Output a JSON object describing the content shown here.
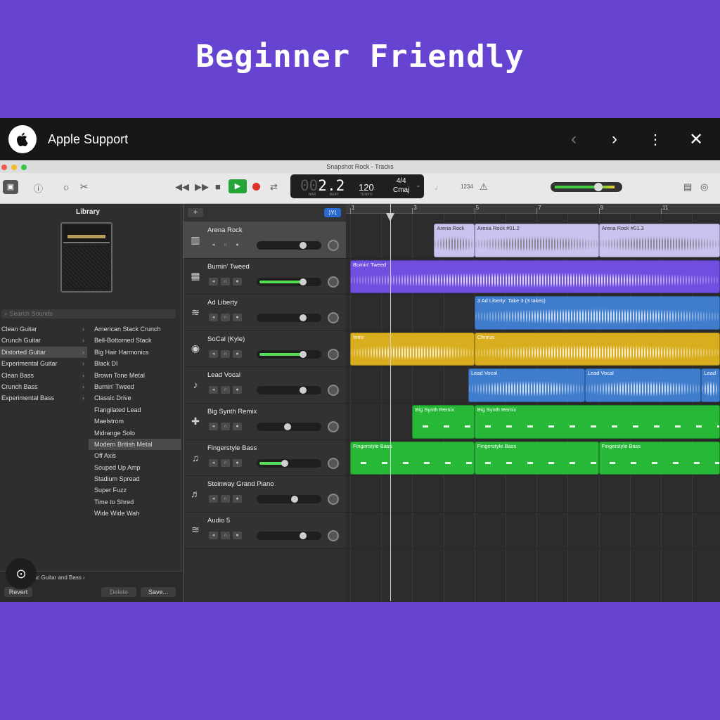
{
  "banner": {
    "title": "Beginner Friendly"
  },
  "video_bar": {
    "channel": "Apple Support",
    "icons": [
      "apple-logo-icon",
      "chevron-left-icon",
      "chevron-right-icon",
      "more-vertical-icon",
      "close-icon"
    ]
  },
  "window": {
    "title": "Snapshot Rock - Tracks"
  },
  "lcd": {
    "position_dim": "00",
    "position": "2.2",
    "tempo": "120",
    "time_signature": "4/4",
    "key": "Cmaj",
    "labels": {
      "bar": "BAR",
      "beat": "BEAT",
      "tempo": "TEMPO"
    }
  },
  "toolbar": {
    "count_in": "1234"
  },
  "library": {
    "title": "Library",
    "search_placeholder": "Search Sounds",
    "categories": [
      "Clean Guitar",
      "Crunch Guitar",
      "Distorted Guitar",
      "Experimental Guitar",
      "Clean Bass",
      "Crunch Bass",
      "Experimental Bass"
    ],
    "selected_category": "Distorted Guitar",
    "patches": [
      "American Stack Crunch",
      "Bell-Bottomed Stack",
      "Big Hair Harmonics",
      "Black DI",
      "Brown Tone Metal",
      "Burnin' Tweed",
      "Classic Drive",
      "Flangilated Lead",
      "Maelstrom",
      "Midrange Solo",
      "Modern British Metal",
      "Off Axis",
      "Souped Up Amp",
      "Stadium Spread",
      "Super Fuzz",
      "Time to Shred",
      "Wide Wide Wah"
    ],
    "selected_patch": "Modern British Metal",
    "breadcrumb": "Electric Guitar and Bass",
    "buttons": {
      "revert": "Revert",
      "delete": "Delete",
      "save": "Save..."
    }
  },
  "tracks": [
    {
      "name": "Arena Rock",
      "icon": "amp-stack-icon",
      "volume": 0.72,
      "selected": true
    },
    {
      "name": "Burnin' Tweed",
      "icon": "tweed-amp-icon",
      "volume": 0.72,
      "active_meter": true
    },
    {
      "name": "Ad Liberty",
      "icon": "waveform-icon",
      "volume": 0.72
    },
    {
      "name": "SoCal (Kyle)",
      "icon": "drum-kit-icon",
      "volume": 0.72,
      "active_meter": true
    },
    {
      "name": "Lead Vocal",
      "icon": "microphone-icon",
      "volume": 0.72
    },
    {
      "name": "Big Synth Remix",
      "icon": "synth-icon",
      "volume": 0.42
    },
    {
      "name": "Fingerstyle Bass",
      "icon": "bass-guitar-icon",
      "volume": 0.36,
      "active_meter": true
    },
    {
      "name": "Steinway Grand Piano",
      "icon": "piano-icon",
      "volume": 0.56
    },
    {
      "name": "Audio 5",
      "icon": "waveform-icon",
      "volume": 0.72
    }
  ],
  "ruler": [
    "1",
    "3",
    "5",
    "7",
    "9",
    "11"
  ],
  "regions": [
    {
      "lane": 0,
      "label": "Arena Rock",
      "color": "#c9c3ef",
      "start": 2.7,
      "end": 4.0,
      "kind": "audio"
    },
    {
      "lane": 0,
      "label": "Arena Rock #01.2",
      "color": "#c9c3ef",
      "start": 4.0,
      "end": 8.0,
      "kind": "audio"
    },
    {
      "lane": 0,
      "label": "Arena Rock #01.3",
      "color": "#c9c3ef",
      "start": 8.0,
      "end": 12.2,
      "kind": "audio"
    },
    {
      "lane": 1,
      "label": "Burnin' Tweed",
      "color": "#6f4ee0",
      "start": 0.0,
      "end": 12.2,
      "kind": "audio"
    },
    {
      "lane": 2,
      "label": "3 Ad Liberty: Take 3 (3 takes)",
      "color": "#3f7ccc",
      "start": 4.0,
      "end": 12.2,
      "kind": "audio"
    },
    {
      "lane": 3,
      "label": "Intro",
      "color": "#d8ae1e",
      "start": 0.0,
      "end": 4.0,
      "kind": "audio"
    },
    {
      "lane": 3,
      "label": "Chorus",
      "color": "#d8ae1e",
      "start": 4.0,
      "end": 12.2,
      "kind": "audio"
    },
    {
      "lane": 4,
      "label": "Lead Vocal",
      "color": "#3f7ccc",
      "start": 3.8,
      "end": 7.55,
      "kind": "audio"
    },
    {
      "lane": 4,
      "label": "Lead Vocal",
      "color": "#3f7ccc",
      "start": 7.55,
      "end": 11.3,
      "kind": "audio"
    },
    {
      "lane": 4,
      "label": "Lead",
      "color": "#3f7ccc",
      "start": 11.3,
      "end": 12.2,
      "kind": "audio"
    },
    {
      "lane": 5,
      "label": "Big Synth Remix",
      "color": "#27b838",
      "start": 2.0,
      "end": 4.0,
      "kind": "midi"
    },
    {
      "lane": 5,
      "label": "Big Synth Remix",
      "color": "#27b838",
      "start": 4.0,
      "end": 12.2,
      "kind": "midi"
    },
    {
      "lane": 6,
      "label": "Fingerstyle Bass",
      "color": "#27b838",
      "start": 0.0,
      "end": 4.0,
      "kind": "midi"
    },
    {
      "lane": 6,
      "label": "Fingerstyle Bass",
      "color": "#27b838",
      "start": 4.0,
      "end": 8.0,
      "kind": "midi"
    },
    {
      "lane": 6,
      "label": "Fingerstyle Bass",
      "color": "#27b838",
      "start": 8.0,
      "end": 12.2,
      "kind": "midi"
    }
  ]
}
